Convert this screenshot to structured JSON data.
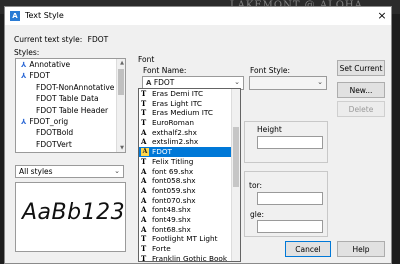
{
  "background": {
    "text": "LAKEMONT @ ALOHA"
  },
  "window": {
    "title": "Text Style",
    "close": "×"
  },
  "current_style": {
    "label": "Current text style:",
    "value": "FDOT"
  },
  "styles": {
    "label": "Styles:",
    "items": [
      {
        "label": "Annotative",
        "annotative": true
      },
      {
        "label": "FDOT",
        "annotative": true
      },
      {
        "label": "FDOT-NonAnnotative",
        "annotative": false
      },
      {
        "label": "FDOT Table Data",
        "annotative": false
      },
      {
        "label": "FDOT Table Header",
        "annotative": false
      },
      {
        "label": "FDOT_orig",
        "annotative": true
      },
      {
        "label": "FDOTBold",
        "annotative": false
      },
      {
        "label": "FDOTVert",
        "annotative": false
      }
    ],
    "filter": "All styles",
    "preview": "AaBb123"
  },
  "font": {
    "group_label": "Font",
    "name_label": "Font Name:",
    "name_value": "FDOT",
    "style_label": "Font Style:",
    "style_value": "",
    "options": [
      {
        "label": "Eras Demi ITC",
        "type": "tt"
      },
      {
        "label": "Eras Light ITC",
        "type": "tt"
      },
      {
        "label": "Eras Medium ITC",
        "type": "tt"
      },
      {
        "label": "EuroRoman",
        "type": "tt"
      },
      {
        "label": "exthalf2.shx",
        "type": "shx"
      },
      {
        "label": "extslim2.shx",
        "type": "shx"
      },
      {
        "label": "FDOT",
        "type": "shx",
        "selected": true
      },
      {
        "label": "Felix Titling",
        "type": "tt"
      },
      {
        "label": "font 69.shx",
        "type": "shx"
      },
      {
        "label": "font058.shx",
        "type": "shx"
      },
      {
        "label": "font059.shx",
        "type": "shx"
      },
      {
        "label": "font070.shx",
        "type": "shx"
      },
      {
        "label": "font48.shx",
        "type": "shx"
      },
      {
        "label": "font49.shx",
        "type": "shx"
      },
      {
        "label": "font68.shx",
        "type": "shx"
      },
      {
        "label": "Footlight MT Light",
        "type": "tt"
      },
      {
        "label": "Forte",
        "type": "tt"
      },
      {
        "label": "Franklin Gothic Book",
        "type": "tt"
      }
    ]
  },
  "size": {
    "height_label": "Height"
  },
  "effects": {
    "factor_label": "tor:",
    "angle_label": "gle:"
  },
  "partial_labels": {
    "size_initial": "S",
    "effects_initial": "E"
  },
  "buttons": {
    "set_current": "Set Current",
    "new": "New...",
    "delete": "Delete",
    "cancel": "Cancel",
    "help": "Help"
  },
  "colors": {
    "accent": "#0078d7",
    "annotative_icon": "#2f6ad6"
  }
}
